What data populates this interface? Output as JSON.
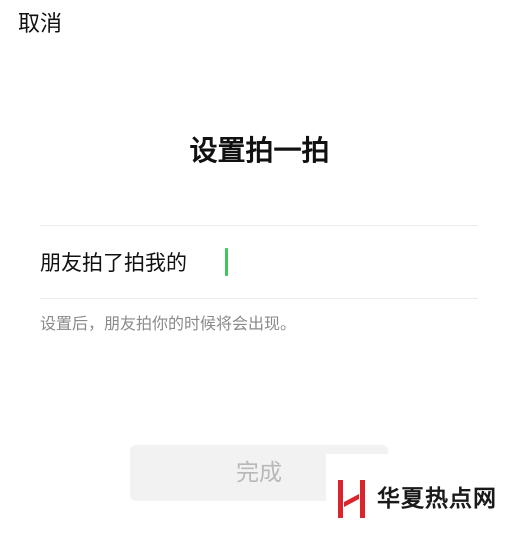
{
  "header": {
    "cancel_label": "取消"
  },
  "page": {
    "title": "设置拍一拍"
  },
  "pat_input": {
    "prefix": "朋友拍了拍我的",
    "value": ""
  },
  "hint": "设置后，朋友拍你的时候将会出现。",
  "done_button": {
    "label": "完成"
  },
  "watermark": {
    "text": "华夏热点网"
  },
  "colors": {
    "caret": "#3ec65a",
    "button_bg": "#f2f2f2",
    "button_text_disabled": "#b8b8b8",
    "hint_text": "#8a8a8a",
    "logo_red": "#d9262c"
  }
}
